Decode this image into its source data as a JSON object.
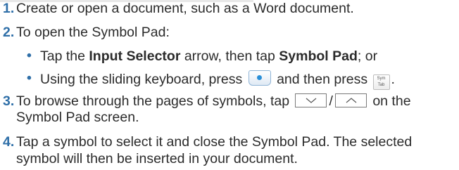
{
  "steps": [
    {
      "num": "1.",
      "text": "Create or open a document, such as a Word document."
    },
    {
      "num": "2.",
      "text": "To open the Symbol Pad:"
    },
    {
      "num": "3.",
      "text_before": "To browse through the pages of symbols, tap",
      "separator": "/",
      "text_after": "on the",
      "text_line2": "Symbol Pad screen."
    },
    {
      "num": "4.",
      "line1": "Tap a symbol to select it and close the Symbol Pad. The selected",
      "line2": "symbol will then be inserted in your document."
    }
  ],
  "bullets": [
    {
      "dot": "•",
      "pre": "Tap the ",
      "bold1": "Input Selector",
      "mid": " arrow, then tap ",
      "bold2": "Symbol Pad",
      "post": "; or"
    },
    {
      "dot": "•",
      "pre": "Using the sliding keyboard, press ",
      "mid": " and then press ",
      "post": "."
    }
  ],
  "keys": {
    "sym_key_line1": "Sym",
    "sym_key_line2": "Tab",
    "dot_key_icon": "blue-dot-key-icon",
    "down_icon": "chevron-down-icon",
    "up_icon": "chevron-up-icon"
  },
  "colors": {
    "accent": "#2f6fa8",
    "text": "#2b2b2b"
  }
}
